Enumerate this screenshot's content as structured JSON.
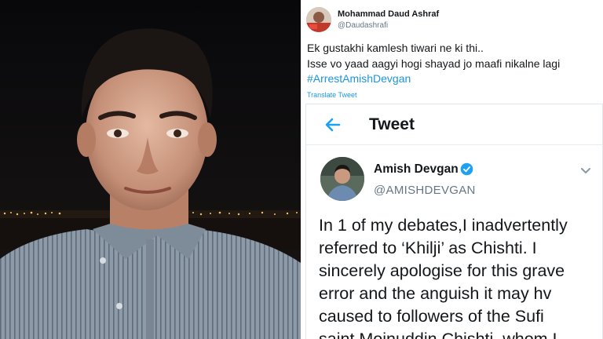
{
  "outer_tweet": {
    "author_name": "Mohammad Daud Ashraf",
    "author_handle": "@Daudashrafi",
    "text_lines": [
      "Ek gustakhi kamlesh tiwari ne ki thi..",
      "Isse vo yaad aagyi hogi shayad jo maafi nikalne lagi"
    ],
    "hashtag": "#ArrestAmishDevgan",
    "translate_label": "Translate Tweet"
  },
  "embedded_tweet": {
    "header_title": "Tweet",
    "author_name": "Amish Devgan",
    "author_handle": "@AMISHDEVGAN",
    "verified": true,
    "body_lines": [
      "In 1 of my debates,I inadvertently",
      "referred to ‘Khilji’ as Chishti. I",
      "sincerely apologise for this grave",
      "error and the anguish it may hv",
      "caused to followers of the Sufi",
      "saint Moinuddin Chishti, whom I"
    ]
  },
  "icons": {
    "back": "arrow-left-icon",
    "verified": "verified-badge-icon",
    "more": "chevron-down-icon"
  },
  "colors": {
    "link": "#1b95e0",
    "text": "#14171a",
    "secondary": "#657786",
    "verified": "#1da1f2"
  }
}
